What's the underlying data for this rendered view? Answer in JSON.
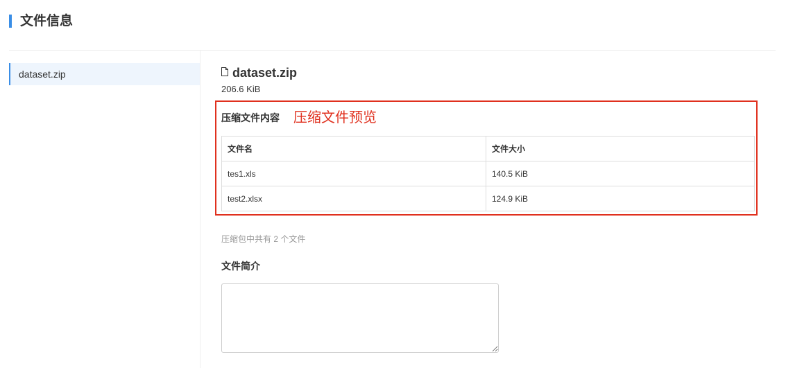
{
  "page": {
    "title": "文件信息"
  },
  "sidebar": {
    "items": [
      {
        "label": "dataset.zip",
        "active": true
      }
    ]
  },
  "file": {
    "name": "dataset.zip",
    "size": "206.6 KiB",
    "icon": "file-icon"
  },
  "archive": {
    "section_title": "压缩文件内容",
    "annotation": "压缩文件预览",
    "columns": [
      "文件名",
      "文件大小"
    ],
    "rows": [
      {
        "name": "tes1.xls",
        "size": "140.5 KiB"
      },
      {
        "name": "test2.xlsx",
        "size": "124.9 KiB"
      }
    ],
    "count_text": "压缩包中共有 2 个文件"
  },
  "description": {
    "title": "文件简介",
    "value": ""
  },
  "colors": {
    "accent": "#3a8ee6",
    "annotation_red": "#e0301e",
    "border": "#dddddd",
    "muted": "#999999"
  }
}
